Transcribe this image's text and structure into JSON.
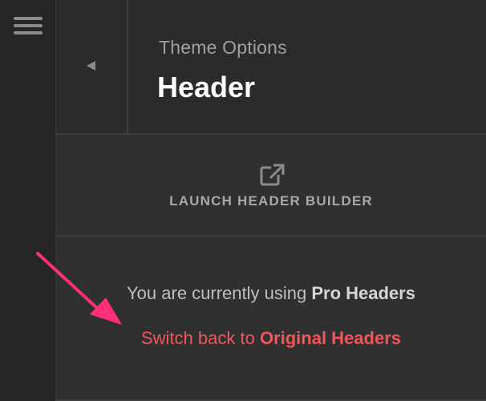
{
  "rail": {
    "menu_icon": "hamburger-menu-icon"
  },
  "header": {
    "back_icon": "back-triangle-icon",
    "subtitle": "Theme Options",
    "title": "Header"
  },
  "launch": {
    "icon": "external-link-icon",
    "label": "LAUNCH HEADER BUILDER"
  },
  "status": {
    "prefix": "You are currently using ",
    "current": "Pro Headers",
    "switch_prefix": "Switch back to ",
    "switch_target": "Original Headers"
  },
  "annotation": {
    "icon": "pink-pointer-arrow",
    "color": "#ff2f7a"
  },
  "colors": {
    "background": "#2a2a2a",
    "panel": "#303030",
    "accent_red": "#f0565a",
    "title": "#ffffff",
    "muted": "#a0a0a0"
  }
}
